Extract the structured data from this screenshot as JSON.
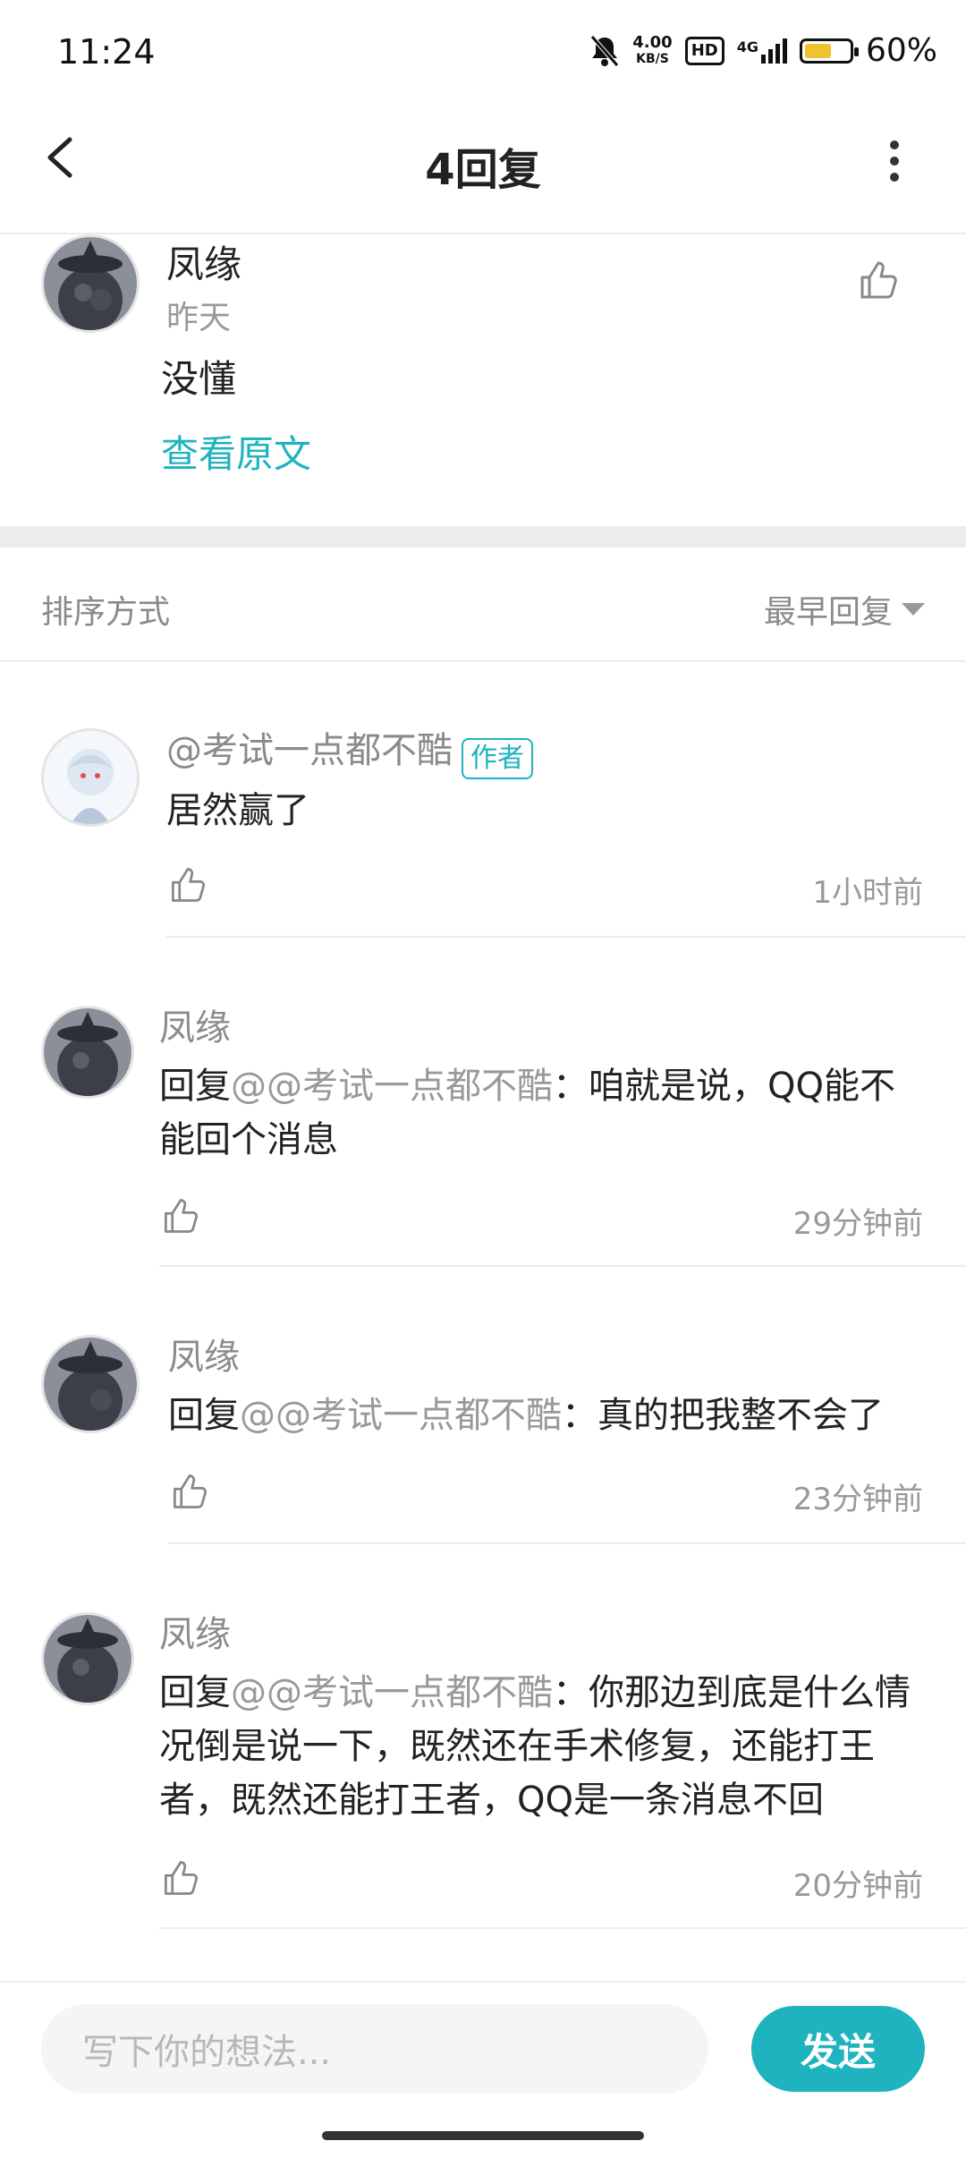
{
  "status": {
    "time": "11:24",
    "speed_top": "4.00",
    "speed_bottom": "KB/S",
    "hd": "HD",
    "network": "4G",
    "battery": "60%",
    "battery_level": 0.6
  },
  "header": {
    "title": "4回复"
  },
  "main_comment": {
    "name": "凤缘",
    "time": "昨天",
    "text": "没懂",
    "view_original": "查看原文"
  },
  "sort": {
    "label": "排序方式",
    "value": "最早回复"
  },
  "replies": [
    {
      "name": "@考试一点都不酷",
      "tag": "作者",
      "text_pre": "",
      "text_at": "",
      "text": "居然赢了",
      "time": "1小时前"
    },
    {
      "name": "凤缘",
      "tag": "",
      "text_pre": "回复",
      "text_at": "@@考试一点都不酷",
      "text": "：咱就是说，QQ能不能回个消息",
      "time": "29分钟前"
    },
    {
      "name": "凤缘",
      "tag": "",
      "text_pre": "回复",
      "text_at": "@@考试一点都不酷",
      "text": "：真的把我整不会了",
      "time": "23分钟前"
    },
    {
      "name": "凤缘",
      "tag": "",
      "text_pre": "回复",
      "text_at": "@@考试一点都不酷",
      "text": "：你那边到底是什么情况倒是说一下，既然还在手术修复，还能打王者，既然还能打王者，QQ是一条消息不回",
      "time": "20分钟前"
    }
  ],
  "input": {
    "placeholder": "写下你的想法..."
  },
  "send": {
    "label": "发送"
  },
  "colors": {
    "accent": "#1fb3bf"
  }
}
